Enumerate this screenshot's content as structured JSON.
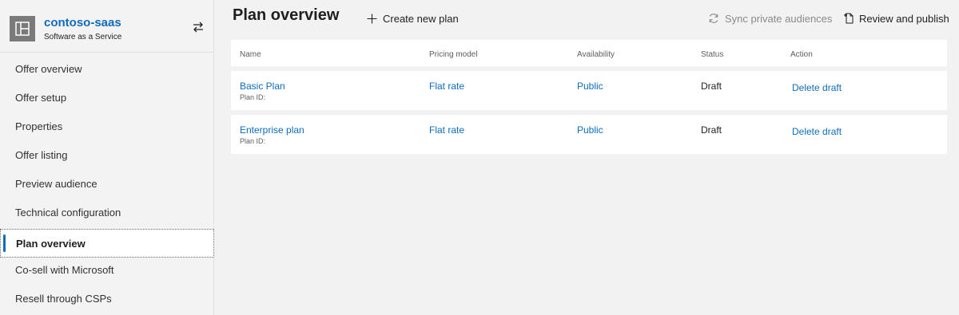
{
  "brand": {
    "name": "contoso-saas",
    "subtitle": "Software as a Service"
  },
  "sidebar": {
    "items": [
      {
        "label": "Offer overview"
      },
      {
        "label": "Offer setup"
      },
      {
        "label": "Properties"
      },
      {
        "label": "Offer listing"
      },
      {
        "label": "Preview audience"
      },
      {
        "label": "Technical configuration"
      },
      {
        "label": "Plan overview",
        "active": true
      },
      {
        "label": "Co-sell with Microsoft"
      },
      {
        "label": "Resell through CSPs"
      }
    ]
  },
  "header": {
    "title": "Plan overview",
    "create_label": "Create new plan",
    "sync_label": "Sync private audiences",
    "review_label": "Review and publish"
  },
  "table": {
    "columns": [
      "Name",
      "Pricing model",
      "Availability",
      "Status",
      "Action"
    ],
    "rows": [
      {
        "name": "Basic Plan",
        "plan_id": "Plan ID:",
        "pricing": "Flat rate",
        "availability": "Public",
        "status": "Draft",
        "action": "Delete draft"
      },
      {
        "name": "Enterprise plan",
        "plan_id": "Plan ID:",
        "pricing": "Flat rate",
        "availability": "Public",
        "status": "Draft",
        "action": "Delete draft"
      }
    ]
  },
  "colors": {
    "accent": "#0f6cbd",
    "background": "#f2f2f2"
  },
  "icons": [
    "app-tile-icon",
    "switch-arrows-icon",
    "plus-icon",
    "sync-icon",
    "document-publish-icon"
  ]
}
